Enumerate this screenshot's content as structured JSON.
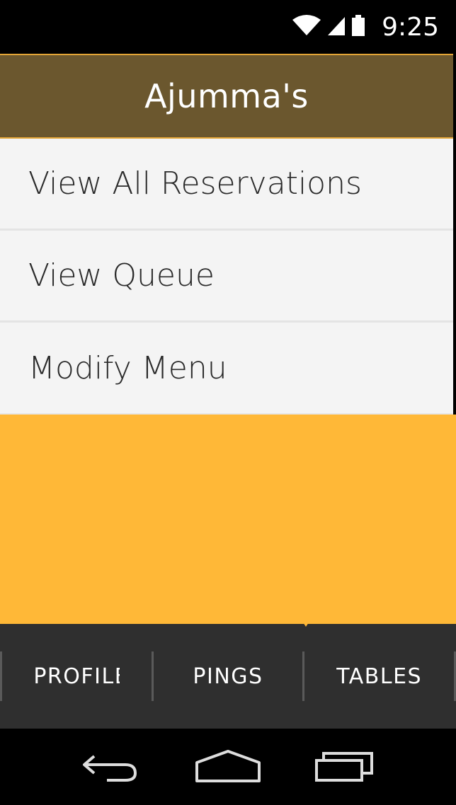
{
  "status_bar": {
    "time": "9:25",
    "icons": [
      "wifi-icon",
      "signal-icon",
      "battery-icon"
    ]
  },
  "app_bar": {
    "title": "Ajumma's",
    "color": "#6b572e"
  },
  "menu": {
    "items": [
      {
        "label": "View All Reservations"
      },
      {
        "label": "View Queue"
      },
      {
        "label": "Modify Menu"
      }
    ]
  },
  "body": {
    "background_color": "#ffb837"
  },
  "tabs": {
    "items": [
      {
        "label": "PROFILE"
      },
      {
        "label": "PINGS"
      },
      {
        "label": "TABLES"
      }
    ]
  },
  "nav_bar": {
    "buttons": [
      "back-icon",
      "home-icon",
      "recent-apps-icon"
    ]
  }
}
